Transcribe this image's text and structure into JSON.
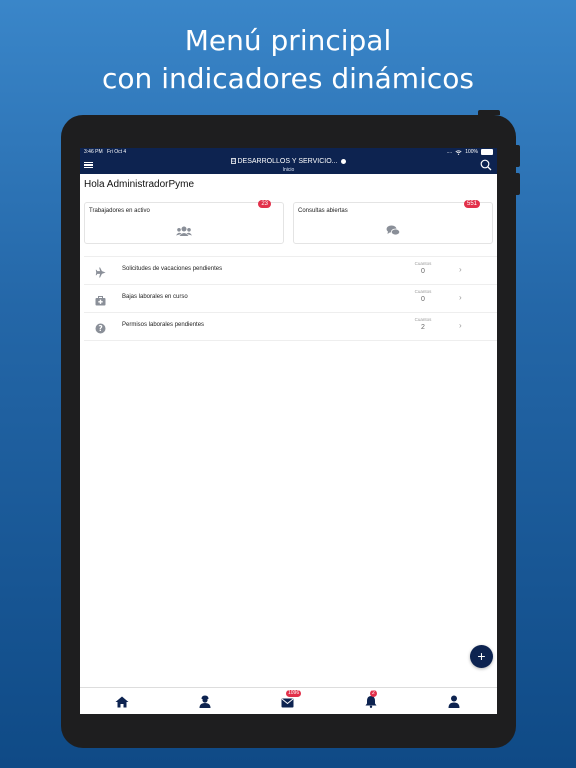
{
  "promo": {
    "line1": "Menú principal",
    "line2": "con indicadores dinámicos"
  },
  "status_bar": {
    "time": "3:46 PM",
    "date": "Fri Oct 4",
    "signal": "....",
    "battery": "100%"
  },
  "header": {
    "company": "DESARROLLOS Y SERVICIO...",
    "subtitle": "Inicio"
  },
  "greeting": "Hola AdministradorPyme",
  "cards": [
    {
      "label": "Trabajadores en activo",
      "badge": "23",
      "icon": "users-icon"
    },
    {
      "label": "Consultas abiertas",
      "badge": "551",
      "icon": "chat-bubbles-icon"
    }
  ],
  "rows": [
    {
      "icon": "plane-icon",
      "label": "Solicitudes de vacaciones pendientes",
      "count_label": "Cuantos",
      "count": "0"
    },
    {
      "icon": "medical-kit-icon",
      "label": "Bajas laborales en curso",
      "count_label": "Cuantos",
      "count": "0"
    },
    {
      "icon": "question-icon",
      "label": "Permisos laborales pendientes",
      "count_label": "Cuantos",
      "count": "2"
    }
  ],
  "fab": "+",
  "tabbar": {
    "items": [
      {
        "icon": "home-icon"
      },
      {
        "icon": "worker-icon"
      },
      {
        "icon": "mail-icon",
        "badge": "1096"
      },
      {
        "icon": "bell-icon",
        "badge": "2"
      },
      {
        "icon": "profile-icon"
      }
    ]
  },
  "colors": {
    "navy": "#0d2350",
    "badge_red": "#e2304a",
    "background_blue": "#2467a8"
  }
}
